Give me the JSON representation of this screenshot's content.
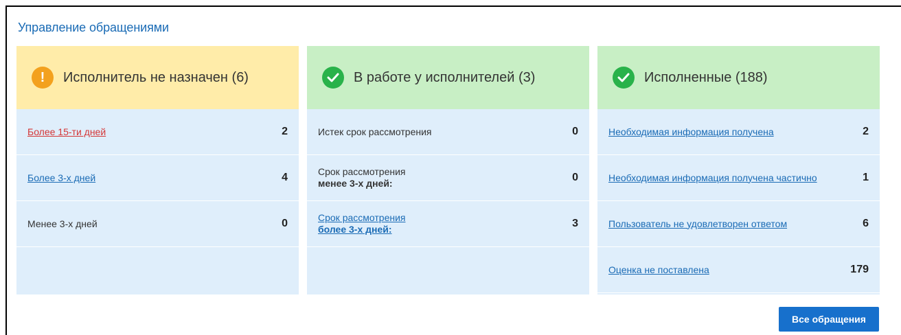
{
  "title": "Управление обращениями",
  "columns": [
    {
      "header": "Исполнитель не назначен (6)",
      "icon": "exclamation-icon",
      "rows": [
        {
          "label": "Более 15-ти дней",
          "value": "2"
        },
        {
          "label": "Более 3-х дней",
          "value": "4"
        },
        {
          "label": "Менее 3-х дней",
          "value": "0"
        }
      ]
    },
    {
      "header": "В работе у исполнителей (3)",
      "icon": "check-icon",
      "rows": [
        {
          "label": "Истек срок рассмотрения",
          "value": "0"
        },
        {
          "label": "Срок рассмотрения",
          "label2": "менее 3-х дней:",
          "value": "0"
        },
        {
          "label": "Срок рассмотрения",
          "label2": "более 3-х дней:",
          "value": "3"
        }
      ]
    },
    {
      "header": "Исполненные (188)",
      "icon": "check-icon",
      "rows": [
        {
          "label": "Необходимая информация получена",
          "value": "2"
        },
        {
          "label": "Необходимая информация получена частично",
          "value": "1"
        },
        {
          "label": "Пользователь не удовлетворен ответом",
          "value": "6"
        },
        {
          "label": "Оценка не поставлена",
          "value": "179"
        }
      ]
    }
  ],
  "button_label": "Все обращения",
  "colors": {
    "accent": "#1770cc",
    "warning": "#f3a11e",
    "success": "#29b24a",
    "link_alert": "#d43636"
  }
}
